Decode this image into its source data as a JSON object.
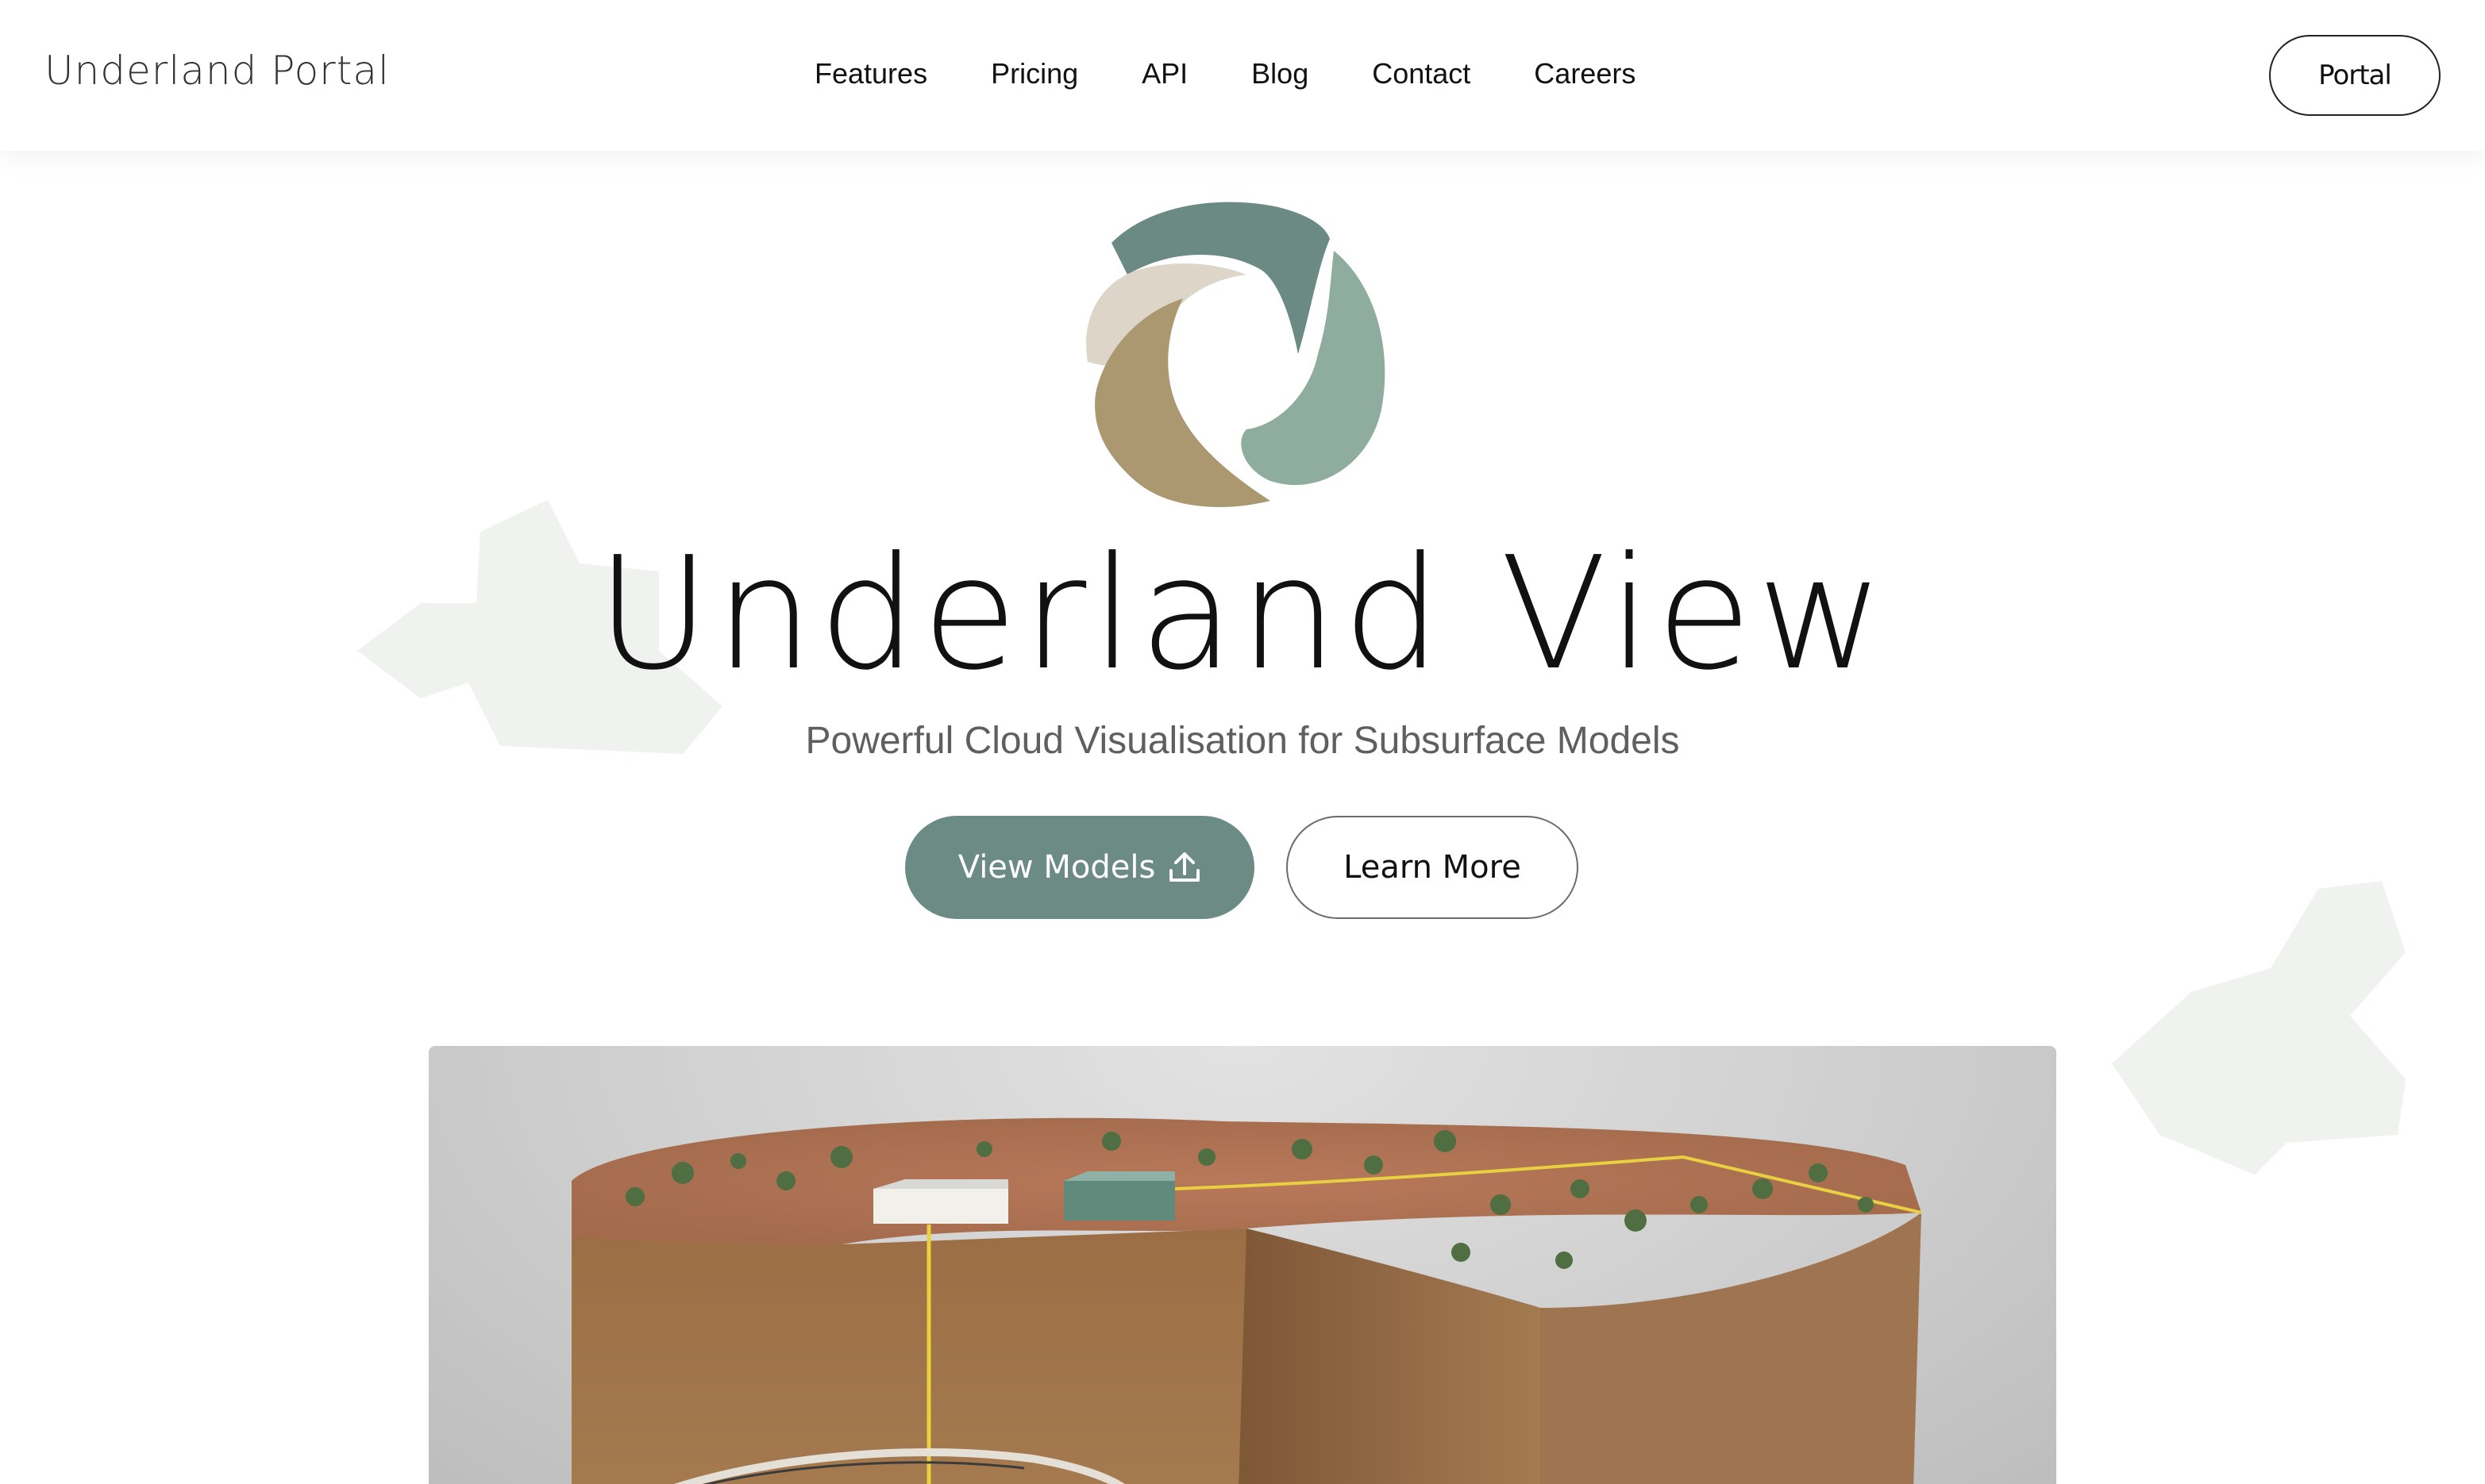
{
  "nav": {
    "brand": "Underland Portal",
    "links": [
      "Features",
      "Pricing",
      "API",
      "Blog",
      "Contact",
      "Careers"
    ],
    "portal_label": "Portal"
  },
  "hero": {
    "logo_icon": "underland-swirl-logo",
    "title": "Underland View",
    "subtitle": "Powerful Cloud Visualisation for Subsurface Models",
    "primary_button": "View Models",
    "primary_button_icon": "upload-icon",
    "secondary_button": "Learn More"
  },
  "colors": {
    "accent": "#6b8b84",
    "logo_dark_teal": "#6b8a83",
    "logo_light_sage": "#8fad9f",
    "logo_sand": "#ab9870",
    "logo_cream": "#ddd6c8",
    "deco_shape": "#eff2ef"
  },
  "illustration": {
    "description_icon": "subsurface-model-image"
  }
}
